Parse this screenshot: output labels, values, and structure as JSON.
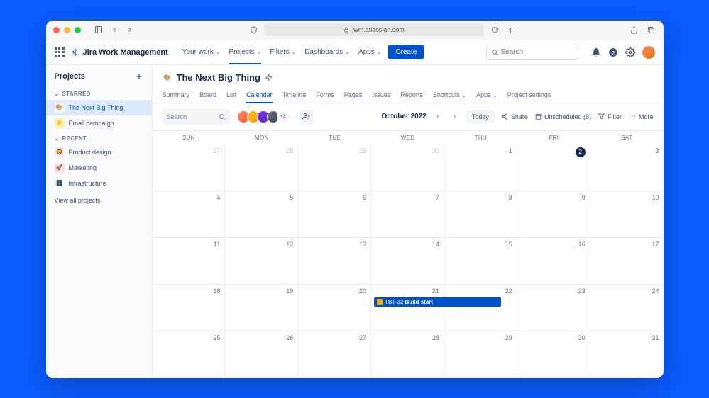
{
  "browser": {
    "url": "jwm.atlassian.com"
  },
  "topnav": {
    "product": "Jira Work Management",
    "items": [
      "Your work",
      "Projects",
      "Filters",
      "Dashboards",
      "Apps"
    ],
    "active_index": 1,
    "create": "Create",
    "search_placeholder": "Search"
  },
  "sidebar": {
    "title": "Projects",
    "sections": [
      {
        "label": "STARRED",
        "items": [
          {
            "label": "The Next Big Thing",
            "icon_class": "pi1",
            "emoji": "🎨",
            "selected": true
          },
          {
            "label": "Email campaign",
            "icon_class": "pi2",
            "emoji": "☀️",
            "selected": false
          }
        ]
      },
      {
        "label": "RECENT",
        "items": [
          {
            "label": "Product design",
            "icon_class": "pi3",
            "emoji": "🦁",
            "selected": false
          },
          {
            "label": "Marketing",
            "icon_class": "pi4",
            "emoji": "🚀",
            "selected": false
          },
          {
            "label": "Infrastructure",
            "icon_class": "pi5",
            "emoji": "🗄️",
            "selected": false
          }
        ]
      }
    ],
    "view_all": "View all projects"
  },
  "project": {
    "title": "The Next Big Thing",
    "tabs": [
      "Summary",
      "Board",
      "List",
      "Calendar",
      "Timeline",
      "Forms",
      "Pages",
      "Issues",
      "Reports",
      "Shortcuts",
      "Apps",
      "Project settings"
    ],
    "active_tab": 3,
    "tab_dropdowns": [
      9,
      10
    ]
  },
  "toolbar": {
    "search_placeholder": "Search",
    "avatar_overflow": "+3",
    "month_label": "October 2022",
    "today": "Today",
    "share": "Share",
    "unscheduled": "Unscheduled (8)",
    "filter": "Filter",
    "more": "More"
  },
  "calendar": {
    "weekdays": [
      "SUN",
      "MON",
      "TUE",
      "WED",
      "THU",
      "FRI",
      "SAT"
    ],
    "days": [
      {
        "n": 27,
        "other": true
      },
      {
        "n": 28,
        "other": true
      },
      {
        "n": 29,
        "other": true
      },
      {
        "n": 30,
        "other": true
      },
      {
        "n": 1
      },
      {
        "n": 2,
        "today": true
      },
      {
        "n": 3
      },
      {
        "n": 4
      },
      {
        "n": 5
      },
      {
        "n": 6
      },
      {
        "n": 7
      },
      {
        "n": 8
      },
      {
        "n": 9
      },
      {
        "n": 10
      },
      {
        "n": 11
      },
      {
        "n": 12
      },
      {
        "n": 13
      },
      {
        "n": 14
      },
      {
        "n": 15
      },
      {
        "n": 16
      },
      {
        "n": 17
      },
      {
        "n": 18
      },
      {
        "n": 19
      },
      {
        "n": 20
      },
      {
        "n": 21,
        "event": {
          "key": "TBT-32",
          "title": "Build start"
        }
      },
      {
        "n": 22
      },
      {
        "n": 23
      },
      {
        "n": 24
      },
      {
        "n": 25
      },
      {
        "n": 26
      },
      {
        "n": 27
      },
      {
        "n": 28
      },
      {
        "n": 29
      },
      {
        "n": 30
      },
      {
        "n": 31
      }
    ]
  }
}
